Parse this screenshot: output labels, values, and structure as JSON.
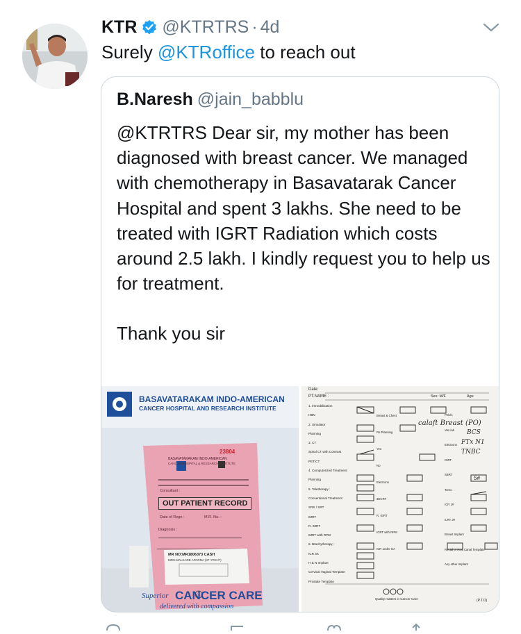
{
  "tweet": {
    "author_name": "KTR",
    "author_handle": "@KTRTRS",
    "separator": "·",
    "time": "4d",
    "text_prefix": "Surely ",
    "text_mention": "@KTRoffice",
    "text_suffix": " to reach out"
  },
  "quoted": {
    "author_name": "B.Naresh",
    "author_handle": "@jain_babblu",
    "body": "@KTRTRS Dear sir, my mother has been diagnosed with breast cancer. We managed with chemotherapy in Basavatarak Cancer Hospital and spent 3 lakhs. She need to be treated with IGRT Radiation which costs around 2.5 lakh. I kindly request you to help us for treatment.",
    "closing": "Thank you sir"
  },
  "photo_left": {
    "hospital_line1": "BASAVATARAKAM INDO-AMERICAN",
    "hospital_line2": "CANCER HOSPITAL AND RESEARCH INSTITUTE",
    "card_number": "23804",
    "card_hospital": "BASAVATARAKAM INDO-AMERICAN",
    "card_hospital2": "CANCER HOSPITAL & RESEARCH INSTITUTE",
    "consultant_label": "Consultant :",
    "record_title": "OUT PATIENT RECORD",
    "date_label": "Date of Regn :",
    "mr_label": "M.R. No. :",
    "diagnosis_label": "Diagnosis :",
    "sticker_line1": "MR NO:MR1806373   CASH",
    "sticker_line2": "MRS.MALKARE APARNA (47 YRS /F)",
    "footer_prefix": "Superior",
    "footer_main": "CANCER CARE",
    "footer_sub": "delivered with compassion"
  },
  "photo_right": {
    "date_label": "Date:",
    "pt_name_label": "PT.NAME :",
    "sex_label": "Sex: M/F",
    "age_label": "Age",
    "sections": [
      "1. Immobilization",
      "HBN",
      "2. Simulator",
      "Planning",
      "3. CT",
      "Spiral CT with Contrast",
      "PET/CT",
      "4. Computerized Treatment Planning",
      "5. Teletherapy :",
      "Conventional Treatment",
      "SRS / SRT",
      "IMRT",
      "R. IMRT",
      "IMRT with RPM",
      "6. Brachytherapy :",
      "ICR 3X",
      "H & N Implant",
      "Cervical Vaginal Template",
      "Prostate Template"
    ],
    "mid_labels": [
      "Breast & Chest",
      "Re Planning",
      "Yes",
      "No",
      "Electrons",
      "3DCRT",
      "R. IGRT",
      "IGRT with RPM",
      "ICR under GA"
    ],
    "right_labels": [
      "Pelvis",
      "Vac-lok",
      "Electrons",
      "IGRT",
      "SBRT",
      "Tomo",
      "ICR 1#",
      "ILRT 3#",
      "Breast Implant",
      "Rectal or Anal Canal Template",
      "Any other Implant"
    ],
    "handwriting1": "calaft Breast (PO)",
    "handwriting2": "BCS",
    "handwriting3": "FTx N1",
    "handwriting4": "TNBC",
    "handwriting5": "5#",
    "footer_text": "Quality matters in Cancer Care",
    "ptd": "(P.T.O)"
  }
}
